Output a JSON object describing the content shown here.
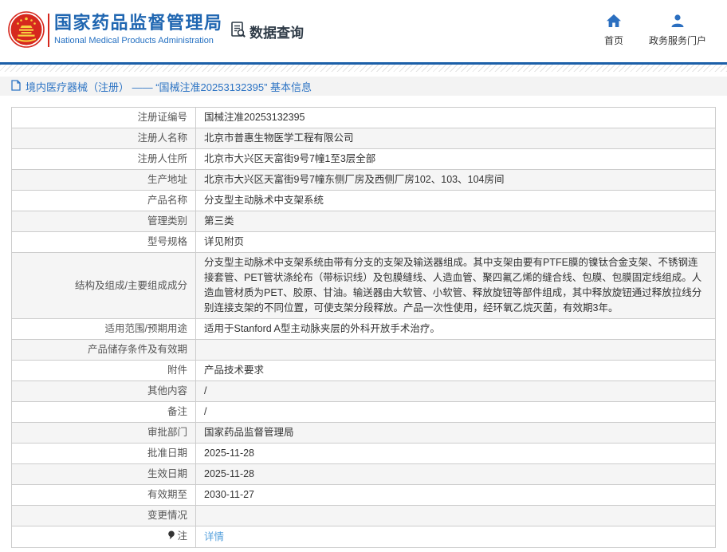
{
  "header": {
    "title": "国家药品监督管理局",
    "subtitle": "National Medical Products Administration",
    "data_query_label": "数据查询",
    "links": [
      {
        "label": "首页",
        "icon": "home-icon"
      },
      {
        "label": "政务服务门户",
        "icon": "user-icon"
      }
    ]
  },
  "breadcrumb": {
    "text": "境内医疗器械（注册） —— “国械注准20253132395” 基本信息"
  },
  "table": {
    "rows": [
      {
        "label": "注册证编号",
        "value": "国械注准20253132395"
      },
      {
        "label": "注册人名称",
        "value": "北京市普惠生物医学工程有限公司"
      },
      {
        "label": "注册人住所",
        "value": "北京市大兴区天富街9号7幢1至3层全部"
      },
      {
        "label": "生产地址",
        "value": "北京市大兴区天富街9号7幢东侧厂房及西侧厂房102、103、104房间"
      },
      {
        "label": "产品名称",
        "value": "分支型主动脉术中支架系统"
      },
      {
        "label": "管理类别",
        "value": "第三类"
      },
      {
        "label": "型号规格",
        "value": "详见附页"
      },
      {
        "label": "结构及组成/主要组成成分",
        "value": "分支型主动脉术中支架系统由带有分支的支架及输送器组成。其中支架由要有PTFE膜的镍钛合金支架、不锈钢连接套管、PET管状涤纶布（带标识线）及包膜缝线、人造血管、聚四氟乙烯的缝合线、包膜、包膜固定线组成。人造血管材质为PET、胶原、甘油。输送器由大软管、小软管、释放旋钮等部件组成，其中释放旋钮通过释放拉线分别连接支架的不同位置，可使支架分段释放。产品一次性使用，经环氧乙烷灭菌，有效期3年。"
      },
      {
        "label": "适用范围/预期用途",
        "value": "适用于Stanford A型主动脉夹层的外科开放手术治疗。"
      },
      {
        "label": "产品储存条件及有效期",
        "value": ""
      },
      {
        "label": "附件",
        "value": "产品技术要求"
      },
      {
        "label": "其他内容",
        "value": "/"
      },
      {
        "label": "备注",
        "value": "/"
      },
      {
        "label": "审批部门",
        "value": "国家药品监督管理局"
      },
      {
        "label": "批准日期",
        "value": "2025-11-28"
      },
      {
        "label": "生效日期",
        "value": "2025-11-28"
      },
      {
        "label": "有效期至",
        "value": "2030-11-27"
      },
      {
        "label": "变更情况",
        "value": ""
      },
      {
        "label": "注",
        "value": "详情",
        "label_icon": "note-icon",
        "link": true
      }
    ]
  },
  "colors": {
    "brand_blue": "#1f66b1",
    "header_line_blue": "#1b5fa8",
    "breadcrumb_text": "#2d74c4",
    "emblem_red": "#d6281e",
    "emblem_gold": "#f7d03f",
    "link_blue": "#54a0dc",
    "alt_row_bg": "#f5f5f5",
    "table_border": "#cccccc"
  }
}
